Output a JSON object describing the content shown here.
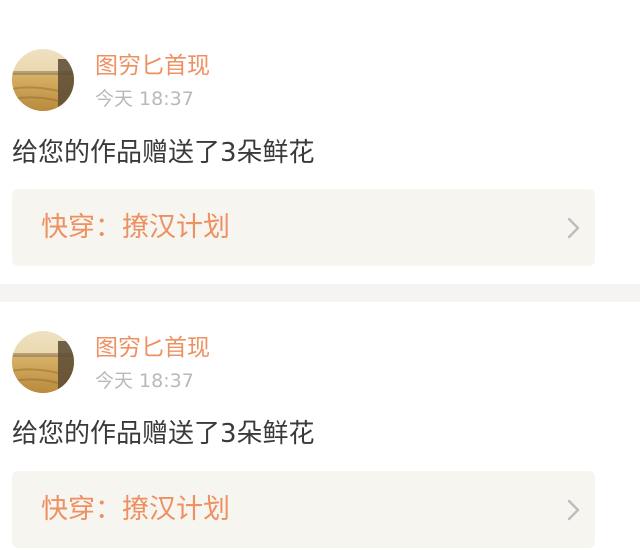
{
  "header": {
    "active_tab_indicator_color": "#e86aa4"
  },
  "colors": {
    "accent": "#ee9062",
    "timestamp": "#b9b9b9",
    "message": "#3a3a3a",
    "link_background": "#f6f5ef",
    "divider": "#f6f4f2"
  },
  "notifications": [
    {
      "avatar_icon": "user-avatar-wheat-field",
      "user_name": "图穷匕首现",
      "timestamp": "今天 18:37",
      "message": "给您的作品赠送了3朵鲜花",
      "work_title": "快穿：撩汉计划",
      "chevron_icon": "chevron-right-icon"
    },
    {
      "avatar_icon": "user-avatar-wheat-field",
      "user_name": "图穷匕首现",
      "timestamp": "今天 18:37",
      "message": "给您的作品赠送了3朵鲜花",
      "work_title": "快穿：撩汉计划",
      "chevron_icon": "chevron-right-icon"
    }
  ]
}
